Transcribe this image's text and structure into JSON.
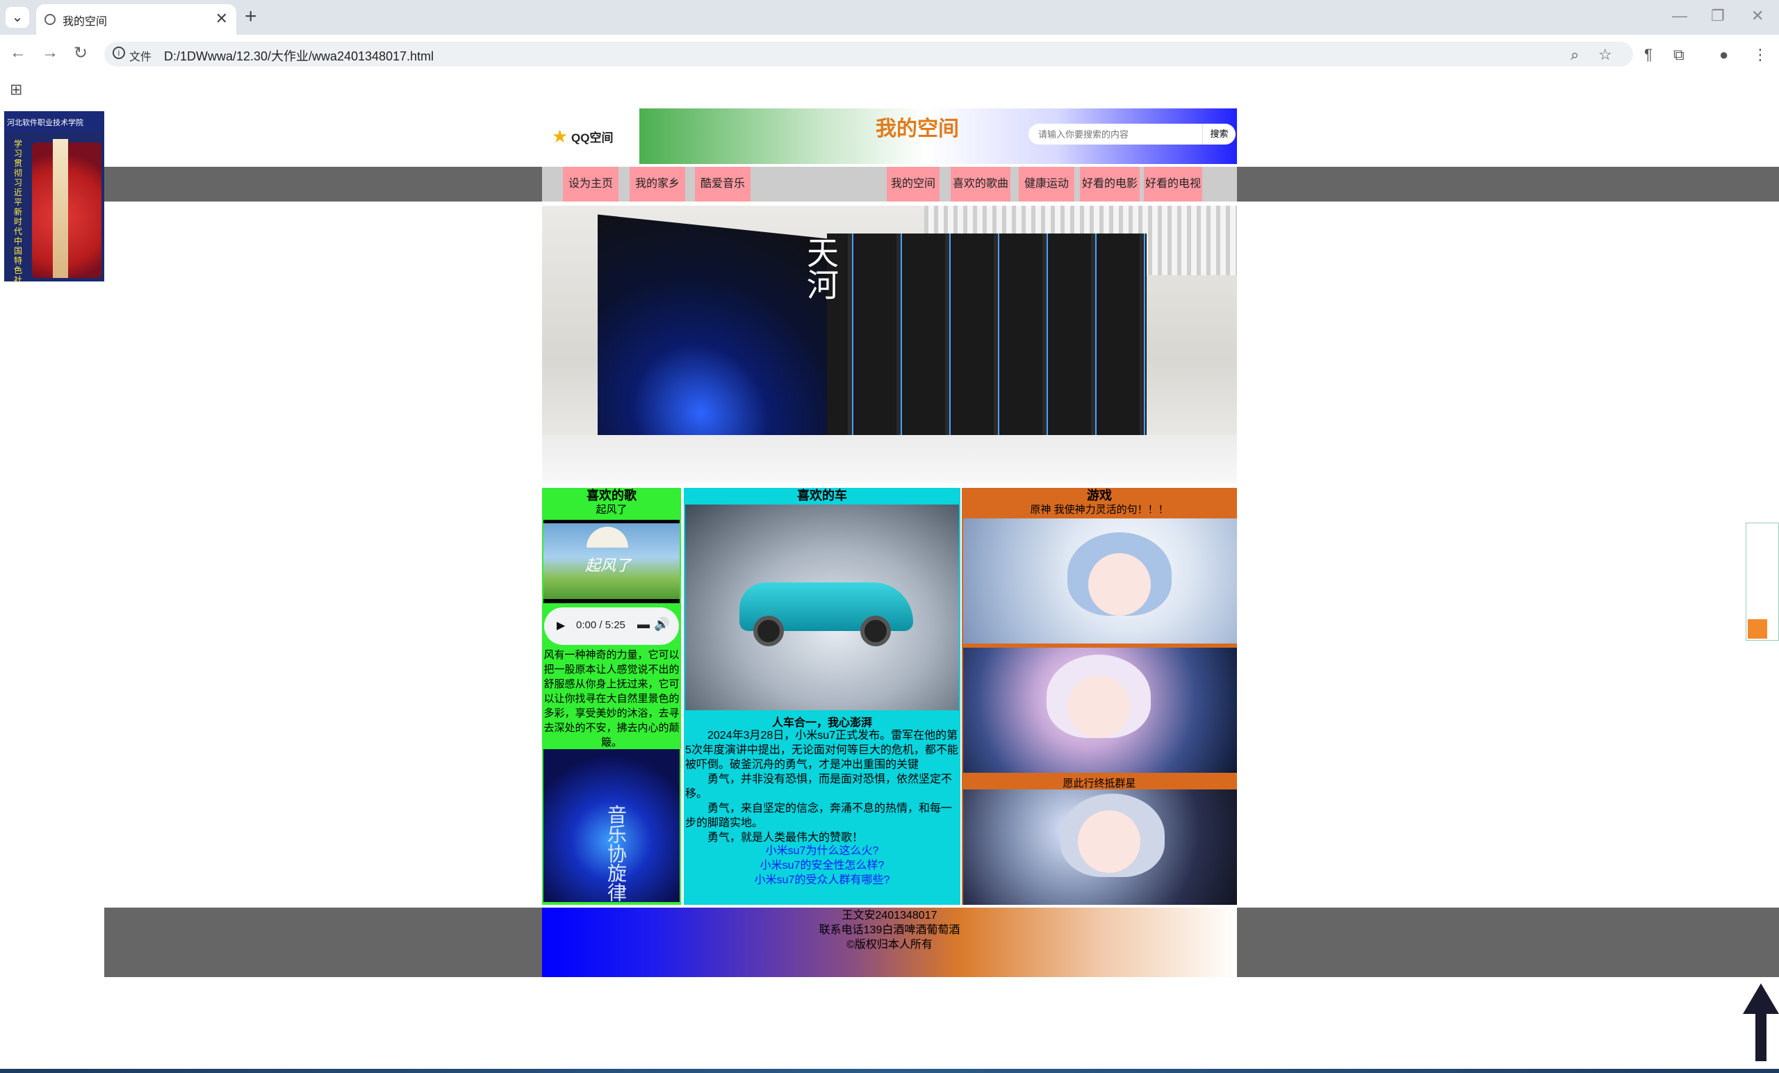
{
  "browser": {
    "tab_title": "我的空间",
    "file_label": "文件",
    "url": "D:/1DWwwa/12.30/大作业/wwa2401348017.html"
  },
  "header": {
    "logo_text": "QQ空间",
    "banner_title": "我的空间",
    "search_placeholder": "请输入你要搜索的内容",
    "search_button": "搜索"
  },
  "nav": {
    "left": [
      "设为主页",
      "我的家乡",
      "酷爱音乐"
    ],
    "right": [
      "我的空间",
      "喜欢的歌曲",
      "健康运动",
      "好看的电影",
      "好看的电视"
    ]
  },
  "hero": {
    "text": "天河"
  },
  "col_song": {
    "title": "喜欢的歌",
    "subtitle": "起风了",
    "cover_text": "起风了",
    "player_time": "0:00 / 5:25",
    "paragraph": "风有一种神奇的力量，它可以把一股原本让人感觉说不出的舒服感从你身上抚过来，它可以让你找寻在大自然里景色的多彩，享受美妙的沐浴，去寻去深处的不安，拂去内心的颠簸。",
    "concert_text": "音乐协旋律"
  },
  "col_car": {
    "title": "喜欢的车",
    "headline": "人车合一，我心澎湃",
    "paragraphs": [
      "2024年3月28日，小米su7正式发布。雷军在他的第5次年度演讲中提出，无论面对何等巨大的危机，都不能被吓倒。破釜沉舟的勇气，才是冲出重围的关键",
      "勇气，并非没有恐惧，而是面对恐惧，依然坚定不移。",
      "勇气，来自坚定的信念，奔涌不息的热情，和每一步的脚踏实地。",
      "勇气，就是人类最伟大的赞歌！"
    ],
    "links": [
      "小米su7为什么这么火?",
      "小米su7的安全性怎么样?",
      "小米su7的受众人群有哪些?"
    ]
  },
  "col_game": {
    "title": "游戏",
    "subtitle": "原神 我使神力灵活的句！！！",
    "caption": "愿此行终抵群星"
  },
  "footer": {
    "lines": [
      "王文安2401348017",
      "联系电话139白酒啤酒葡萄酒",
      "©版权归本人所有"
    ]
  },
  "ad": {
    "top_text": "河北软件职业技术学院",
    "side_text": "学习贯彻习近平新时代中国特色社"
  },
  "colors": {
    "song_bg": "#33ee33",
    "car_bg": "#0ad4dc",
    "game_bg": "#d86a1f",
    "nav_item": "#ff9aa2",
    "banner_title": "#e07b1a"
  }
}
